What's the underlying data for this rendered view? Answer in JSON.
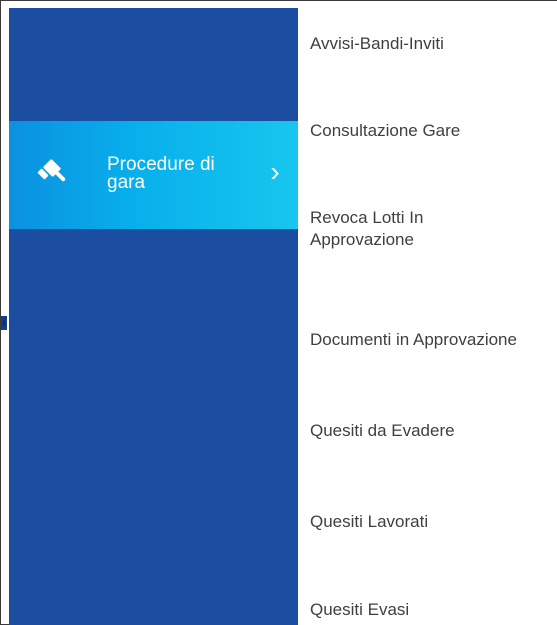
{
  "menu": {
    "active": {
      "label_line1": "Procedure di",
      "label_line2": "gara",
      "icon": "gavel-icon",
      "accent_color": "#08b0ec"
    },
    "sidebar_color": "#1b4ea0",
    "items": [
      {
        "label": "Avvisi-Bandi-Inviti"
      },
      {
        "label": "Consultazione Gare"
      },
      {
        "label": "Revoca Lotti In Approvazione"
      },
      {
        "label": "Documenti in Approvazione"
      },
      {
        "label": "Quesiti da Evadere"
      },
      {
        "label": "Quesiti Lavorati"
      },
      {
        "label": "Quesiti Evasi"
      }
    ]
  }
}
